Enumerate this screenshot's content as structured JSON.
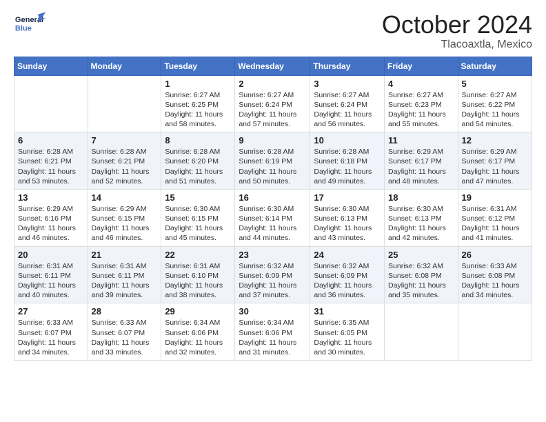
{
  "header": {
    "logo_general": "General",
    "logo_blue": "Blue",
    "month": "October 2024",
    "location": "Tlacoaxtla, Mexico"
  },
  "days_of_week": [
    "Sunday",
    "Monday",
    "Tuesday",
    "Wednesday",
    "Thursday",
    "Friday",
    "Saturday"
  ],
  "weeks": [
    [
      {
        "day": "",
        "sunrise": "",
        "sunset": "",
        "daylight": ""
      },
      {
        "day": "",
        "sunrise": "",
        "sunset": "",
        "daylight": ""
      },
      {
        "day": "1",
        "sunrise": "Sunrise: 6:27 AM",
        "sunset": "Sunset: 6:25 PM",
        "daylight": "Daylight: 11 hours and 58 minutes."
      },
      {
        "day": "2",
        "sunrise": "Sunrise: 6:27 AM",
        "sunset": "Sunset: 6:24 PM",
        "daylight": "Daylight: 11 hours and 57 minutes."
      },
      {
        "day": "3",
        "sunrise": "Sunrise: 6:27 AM",
        "sunset": "Sunset: 6:24 PM",
        "daylight": "Daylight: 11 hours and 56 minutes."
      },
      {
        "day": "4",
        "sunrise": "Sunrise: 6:27 AM",
        "sunset": "Sunset: 6:23 PM",
        "daylight": "Daylight: 11 hours and 55 minutes."
      },
      {
        "day": "5",
        "sunrise": "Sunrise: 6:27 AM",
        "sunset": "Sunset: 6:22 PM",
        "daylight": "Daylight: 11 hours and 54 minutes."
      }
    ],
    [
      {
        "day": "6",
        "sunrise": "Sunrise: 6:28 AM",
        "sunset": "Sunset: 6:21 PM",
        "daylight": "Daylight: 11 hours and 53 minutes."
      },
      {
        "day": "7",
        "sunrise": "Sunrise: 6:28 AM",
        "sunset": "Sunset: 6:21 PM",
        "daylight": "Daylight: 11 hours and 52 minutes."
      },
      {
        "day": "8",
        "sunrise": "Sunrise: 6:28 AM",
        "sunset": "Sunset: 6:20 PM",
        "daylight": "Daylight: 11 hours and 51 minutes."
      },
      {
        "day": "9",
        "sunrise": "Sunrise: 6:28 AM",
        "sunset": "Sunset: 6:19 PM",
        "daylight": "Daylight: 11 hours and 50 minutes."
      },
      {
        "day": "10",
        "sunrise": "Sunrise: 6:28 AM",
        "sunset": "Sunset: 6:18 PM",
        "daylight": "Daylight: 11 hours and 49 minutes."
      },
      {
        "day": "11",
        "sunrise": "Sunrise: 6:29 AM",
        "sunset": "Sunset: 6:17 PM",
        "daylight": "Daylight: 11 hours and 48 minutes."
      },
      {
        "day": "12",
        "sunrise": "Sunrise: 6:29 AM",
        "sunset": "Sunset: 6:17 PM",
        "daylight": "Daylight: 11 hours and 47 minutes."
      }
    ],
    [
      {
        "day": "13",
        "sunrise": "Sunrise: 6:29 AM",
        "sunset": "Sunset: 6:16 PM",
        "daylight": "Daylight: 11 hours and 46 minutes."
      },
      {
        "day": "14",
        "sunrise": "Sunrise: 6:29 AM",
        "sunset": "Sunset: 6:15 PM",
        "daylight": "Daylight: 11 hours and 46 minutes."
      },
      {
        "day": "15",
        "sunrise": "Sunrise: 6:30 AM",
        "sunset": "Sunset: 6:15 PM",
        "daylight": "Daylight: 11 hours and 45 minutes."
      },
      {
        "day": "16",
        "sunrise": "Sunrise: 6:30 AM",
        "sunset": "Sunset: 6:14 PM",
        "daylight": "Daylight: 11 hours and 44 minutes."
      },
      {
        "day": "17",
        "sunrise": "Sunrise: 6:30 AM",
        "sunset": "Sunset: 6:13 PM",
        "daylight": "Daylight: 11 hours and 43 minutes."
      },
      {
        "day": "18",
        "sunrise": "Sunrise: 6:30 AM",
        "sunset": "Sunset: 6:13 PM",
        "daylight": "Daylight: 11 hours and 42 minutes."
      },
      {
        "day": "19",
        "sunrise": "Sunrise: 6:31 AM",
        "sunset": "Sunset: 6:12 PM",
        "daylight": "Daylight: 11 hours and 41 minutes."
      }
    ],
    [
      {
        "day": "20",
        "sunrise": "Sunrise: 6:31 AM",
        "sunset": "Sunset: 6:11 PM",
        "daylight": "Daylight: 11 hours and 40 minutes."
      },
      {
        "day": "21",
        "sunrise": "Sunrise: 6:31 AM",
        "sunset": "Sunset: 6:11 PM",
        "daylight": "Daylight: 11 hours and 39 minutes."
      },
      {
        "day": "22",
        "sunrise": "Sunrise: 6:31 AM",
        "sunset": "Sunset: 6:10 PM",
        "daylight": "Daylight: 11 hours and 38 minutes."
      },
      {
        "day": "23",
        "sunrise": "Sunrise: 6:32 AM",
        "sunset": "Sunset: 6:09 PM",
        "daylight": "Daylight: 11 hours and 37 minutes."
      },
      {
        "day": "24",
        "sunrise": "Sunrise: 6:32 AM",
        "sunset": "Sunset: 6:09 PM",
        "daylight": "Daylight: 11 hours and 36 minutes."
      },
      {
        "day": "25",
        "sunrise": "Sunrise: 6:32 AM",
        "sunset": "Sunset: 6:08 PM",
        "daylight": "Daylight: 11 hours and 35 minutes."
      },
      {
        "day": "26",
        "sunrise": "Sunrise: 6:33 AM",
        "sunset": "Sunset: 6:08 PM",
        "daylight": "Daylight: 11 hours and 34 minutes."
      }
    ],
    [
      {
        "day": "27",
        "sunrise": "Sunrise: 6:33 AM",
        "sunset": "Sunset: 6:07 PM",
        "daylight": "Daylight: 11 hours and 34 minutes."
      },
      {
        "day": "28",
        "sunrise": "Sunrise: 6:33 AM",
        "sunset": "Sunset: 6:07 PM",
        "daylight": "Daylight: 11 hours and 33 minutes."
      },
      {
        "day": "29",
        "sunrise": "Sunrise: 6:34 AM",
        "sunset": "Sunset: 6:06 PM",
        "daylight": "Daylight: 11 hours and 32 minutes."
      },
      {
        "day": "30",
        "sunrise": "Sunrise: 6:34 AM",
        "sunset": "Sunset: 6:06 PM",
        "daylight": "Daylight: 11 hours and 31 minutes."
      },
      {
        "day": "31",
        "sunrise": "Sunrise: 6:35 AM",
        "sunset": "Sunset: 6:05 PM",
        "daylight": "Daylight: 11 hours and 30 minutes."
      },
      {
        "day": "",
        "sunrise": "",
        "sunset": "",
        "daylight": ""
      },
      {
        "day": "",
        "sunrise": "",
        "sunset": "",
        "daylight": ""
      }
    ]
  ]
}
